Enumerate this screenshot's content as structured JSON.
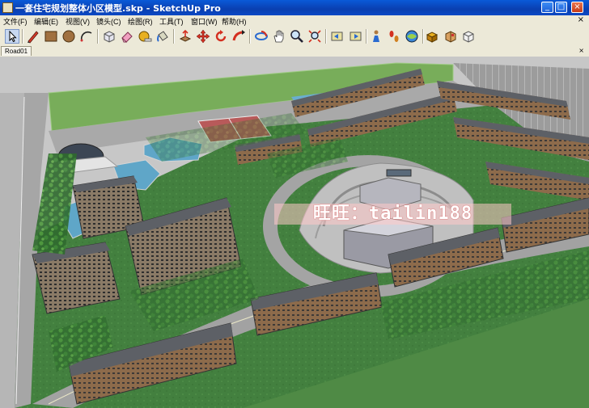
{
  "window": {
    "title": "一套住宅规划整体小区模型.skp - SketchUp Pro",
    "minimize": "_",
    "maximize": "□",
    "close": "×"
  },
  "menu": {
    "items": [
      "文件(F)",
      "编辑(E)",
      "视图(V)",
      "镜头(C)",
      "绘图(R)",
      "工具(T)",
      "窗口(W)",
      "帮助(H)"
    ],
    "close_glyph": "×"
  },
  "toolbar": {
    "tools": [
      "select",
      "line",
      "rectangle",
      "circle",
      "arc",
      "make-component",
      "eraser",
      "tape-measure",
      "paint-bucket",
      "push-pull",
      "move",
      "rotate",
      "follow-me",
      "orbit",
      "pan",
      "zoom",
      "zoom-extents",
      "previous-view",
      "next-view",
      "section-plane",
      "walk",
      "position-camera",
      "look-around",
      "components",
      "materials",
      "styles"
    ]
  },
  "tabs": {
    "active": "Road01",
    "close_glyph": "×"
  },
  "watermark": {
    "label": "旺旺：tailin188"
  },
  "colors": {
    "grass": "#3f7a3a",
    "lawn": "#78ad5a",
    "road": "#a0a0a0",
    "plaza": "#bcbcbc",
    "roof": "#5d6066",
    "facade": "#8a6a4a",
    "water": "#5fa6c8"
  }
}
